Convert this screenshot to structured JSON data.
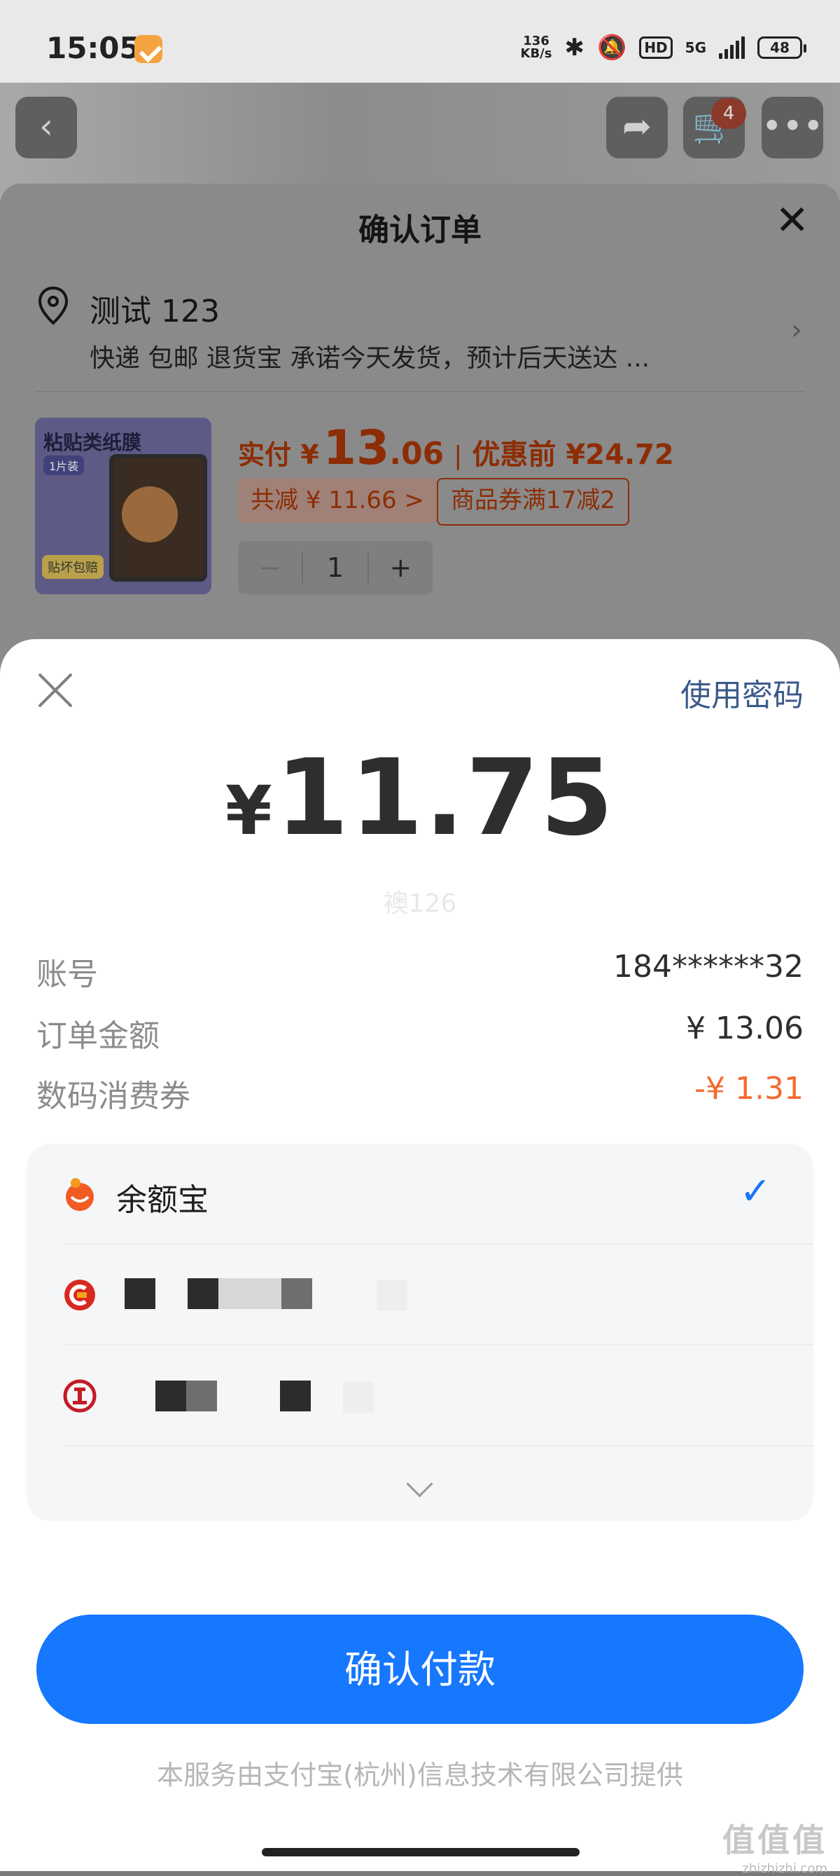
{
  "status_bar": {
    "time": "15:05",
    "net_speed_top": "136",
    "net_speed_unit": "KB/s",
    "hd": "HD",
    "network": "5G",
    "battery": "48"
  },
  "background_page": {
    "cart_count": "4"
  },
  "order_sheet": {
    "title": "确认订单",
    "address_name": "测试 123",
    "address_detail": "快递 包邮 退货宝 承诺今天发货，预计后天送达 ...",
    "product_image_title": "粘贴类纸膜",
    "product_image_tag": "1片装",
    "product_image_badge": "贴坏包赔",
    "pay_label": "实付 ¥",
    "pay_int": "13",
    "pay_dec": ".06",
    "separator": "|",
    "before_discount": "优惠前 ¥24.72",
    "total_reduce": "共减 ¥ 11.66 >",
    "coupon": "商品券满17减2",
    "qty_minus": "−",
    "qty": "1",
    "qty_plus": "+"
  },
  "pay_sheet": {
    "use_password": "使用密码",
    "currency": "¥",
    "amount": "11.75",
    "faint_text": "襖126",
    "rows": [
      {
        "label": "账号",
        "value": "184******32"
      },
      {
        "label": "订单金额",
        "value": "¥ 13.06"
      },
      {
        "label": "数码消费券",
        "value": "-¥ 1.31"
      }
    ],
    "methods": [
      {
        "name": "余额宝",
        "selected": true
      }
    ],
    "confirm": "确认付款",
    "provider": "本服务由支付宝(杭州)信息技术有限公司提供"
  },
  "watermark": {
    "logo": "值值值",
    "url": "zhizhizhi.com"
  },
  "colors": {
    "accent_blue": "#1677ff",
    "discount_orange": "#f26b2f",
    "check_blue": "#1976f5"
  }
}
